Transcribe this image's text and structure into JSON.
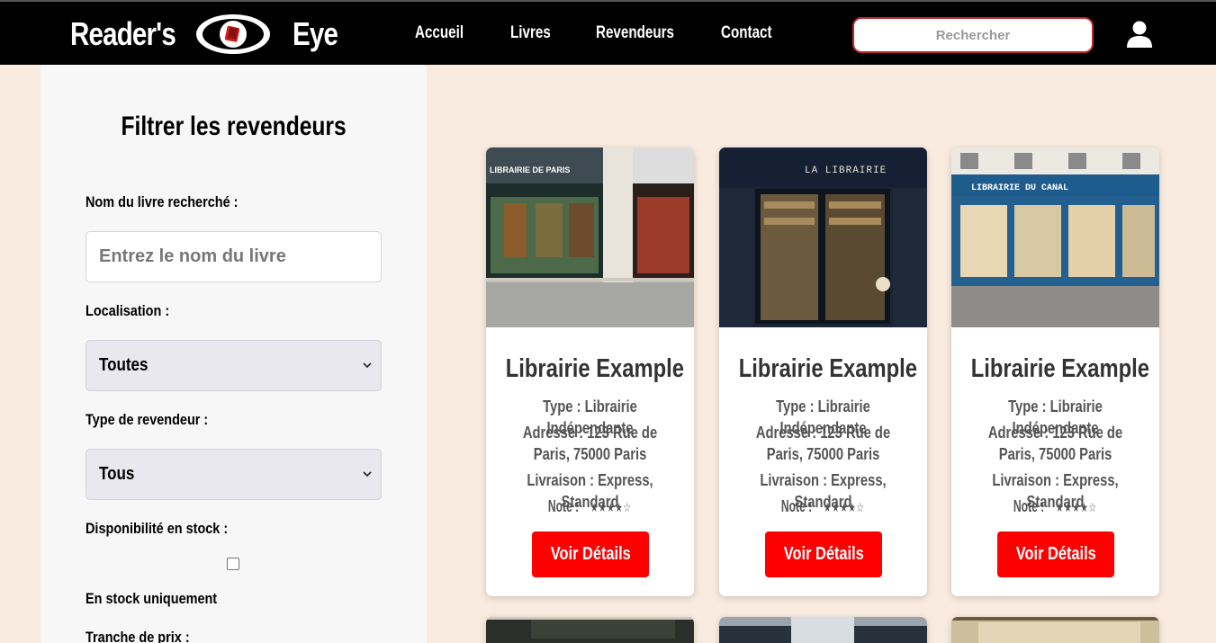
{
  "navbar": {
    "brand_left": "Reader's",
    "brand_right": "Eye",
    "links": [
      {
        "label": "Accueil"
      },
      {
        "label": "Livres"
      },
      {
        "label": "Revendeurs"
      },
      {
        "label": "Contact"
      }
    ],
    "search_placeholder": "Rechercher"
  },
  "sidebar": {
    "title": "Filtrer les revendeurs",
    "book_name_label": "Nom du livre recherché :",
    "book_name_placeholder": "Entrez le nom du livre",
    "location_label": "Localisation :",
    "location_value": "Toutes",
    "type_label": "Type de revendeur :",
    "type_value": "Tous",
    "stock_label": "Disponibilité en stock :",
    "stock_checkbox_label": "En stock uniquement",
    "price_label": "Tranche de prix :"
  },
  "cards": [
    {
      "name": "Librairie Example",
      "type": "Type : Librairie Indépendante",
      "address": "Adresse : 123 Rue de Paris, 75000 Paris",
      "delivery": "Livraison : Express, Standard",
      "rating_label": "Note :",
      "rating_stars": "★★★★☆",
      "rating": 4,
      "button": "Voir Détails",
      "image_sign": "LIBRAIRIE DE PARIS"
    },
    {
      "name": "Librairie Example",
      "type": "Type : Librairie Indépendante",
      "address": "Adresse : 123 Rue de Paris, 75000 Paris",
      "delivery": "Livraison : Express, Standard",
      "rating_label": "Note :",
      "rating_stars": "★★★★☆",
      "rating": 4,
      "button": "Voir Détails",
      "image_sign": "LA LIBRAIRIE"
    },
    {
      "name": "Librairie Example",
      "type": "Type : Librairie Indépendante",
      "address": "Adresse : 123 Rue de Paris, 75000 Paris",
      "delivery": "Livraison : Express, Standard",
      "rating_label": "Note :",
      "rating_stars": "★★★★☆",
      "rating": 4,
      "button": "Voir Détails",
      "image_sign": "LIBRAIRIE DU CANAL"
    }
  ],
  "colors": {
    "navbar_bg": "#000000",
    "page_bg": "#f9ebdf",
    "accent_red": "#ff0000",
    "search_border": "#c0272d"
  }
}
